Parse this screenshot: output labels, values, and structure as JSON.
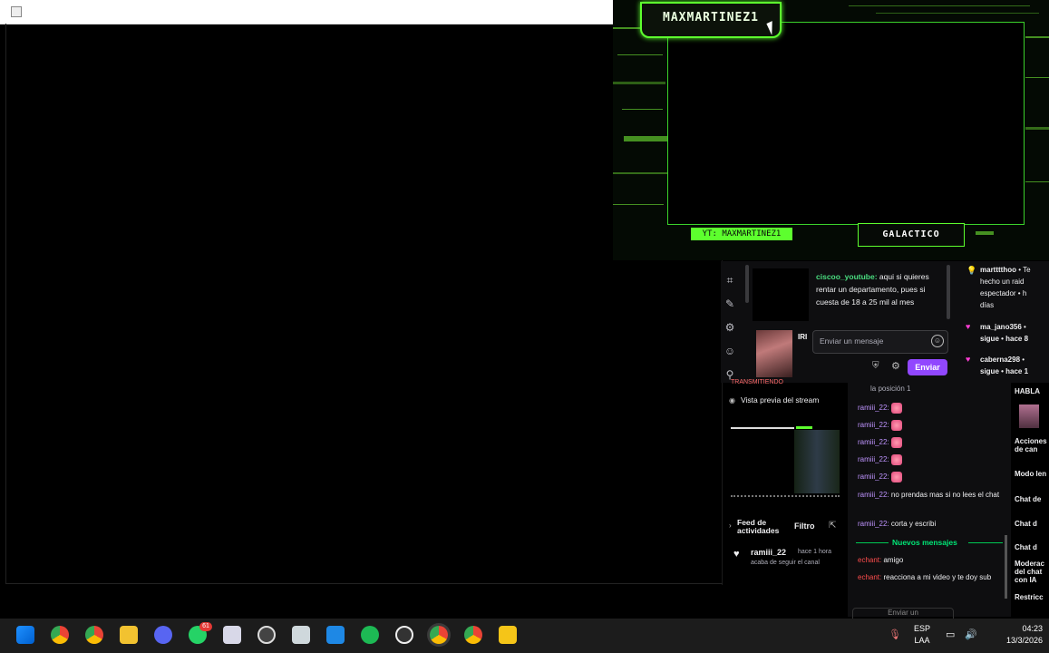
{
  "overlay": {
    "streamer_name": "MAXMARTINEZ1",
    "youtube_tag": "YT: MAXMARTINEZ1",
    "rank_tag": "GALACTICO",
    "accent": "#5dff2e"
  },
  "stream_panel": {
    "chat_message": {
      "user": "ciscoo_youtube:",
      "text": " aqui si quieres rentar un departamento, pues si cuesta de 18 a 25 mil al mes"
    },
    "thumb_label": "IRI",
    "chat_placeholder": "Enviar un mensaje",
    "send_label": "Enviar",
    "events": [
      {
        "user": "martttthoo",
        "text": "• Te",
        "extra": "hecho un raid",
        "extra2": "espectador • h",
        "extra3": "días"
      },
      {
        "user": "ma_jano356",
        "text": "•",
        "extra": "sigue • hace 8"
      },
      {
        "user": "caberna298",
        "text": "•",
        "extra": "sigue • hace 1"
      }
    ]
  },
  "mod_panel": {
    "transmitiendo": "TRANSMITIENDO",
    "preview_label": "Vista previa del stream",
    "feed_label": "Feed de actividades",
    "filter_label": "Filtro",
    "feed_item": {
      "user": "ramiii_22",
      "time": "hace 1 hora",
      "desc": "acaba de seguir el canal"
    }
  },
  "main_chat": {
    "position_text": "la posición 1",
    "lines": [
      {
        "user": "ramiii_22:",
        "text": "",
        "emote": true
      },
      {
        "user": "ramiii_22:",
        "text": "",
        "emote": true
      },
      {
        "user": "ramiii_22:",
        "text": "",
        "emote": true
      },
      {
        "user": "ramiii_22:",
        "text": "",
        "emote": true
      },
      {
        "user": "ramiii_22:",
        "text": "",
        "emote": true
      },
      {
        "user": "ramiii_22:",
        "text": " no prendas mas si no lees el chat"
      },
      {
        "user": "ramiii_22:",
        "text": " corta y escribi"
      }
    ],
    "new_messages_label": "Nuevos mensajes",
    "new_lines": [
      {
        "user": "echant:",
        "text": " amigo"
      },
      {
        "user": "echant:",
        "text": " reacciona a mi video y te doy sub"
      }
    ],
    "input_placeholder": "Enviar un"
  },
  "right_column": {
    "items": [
      "HABLA",
      "Acciones de can",
      "Modo len",
      "Chat de",
      "Chat d",
      "Chat d",
      "Moderac del chat con IA",
      "Restricc"
    ]
  },
  "taskbar": {
    "lang_line1": "ESP",
    "lang_line2": "LAA",
    "time": "04:23",
    "date": "13/3/2026",
    "badge_count": "61"
  }
}
